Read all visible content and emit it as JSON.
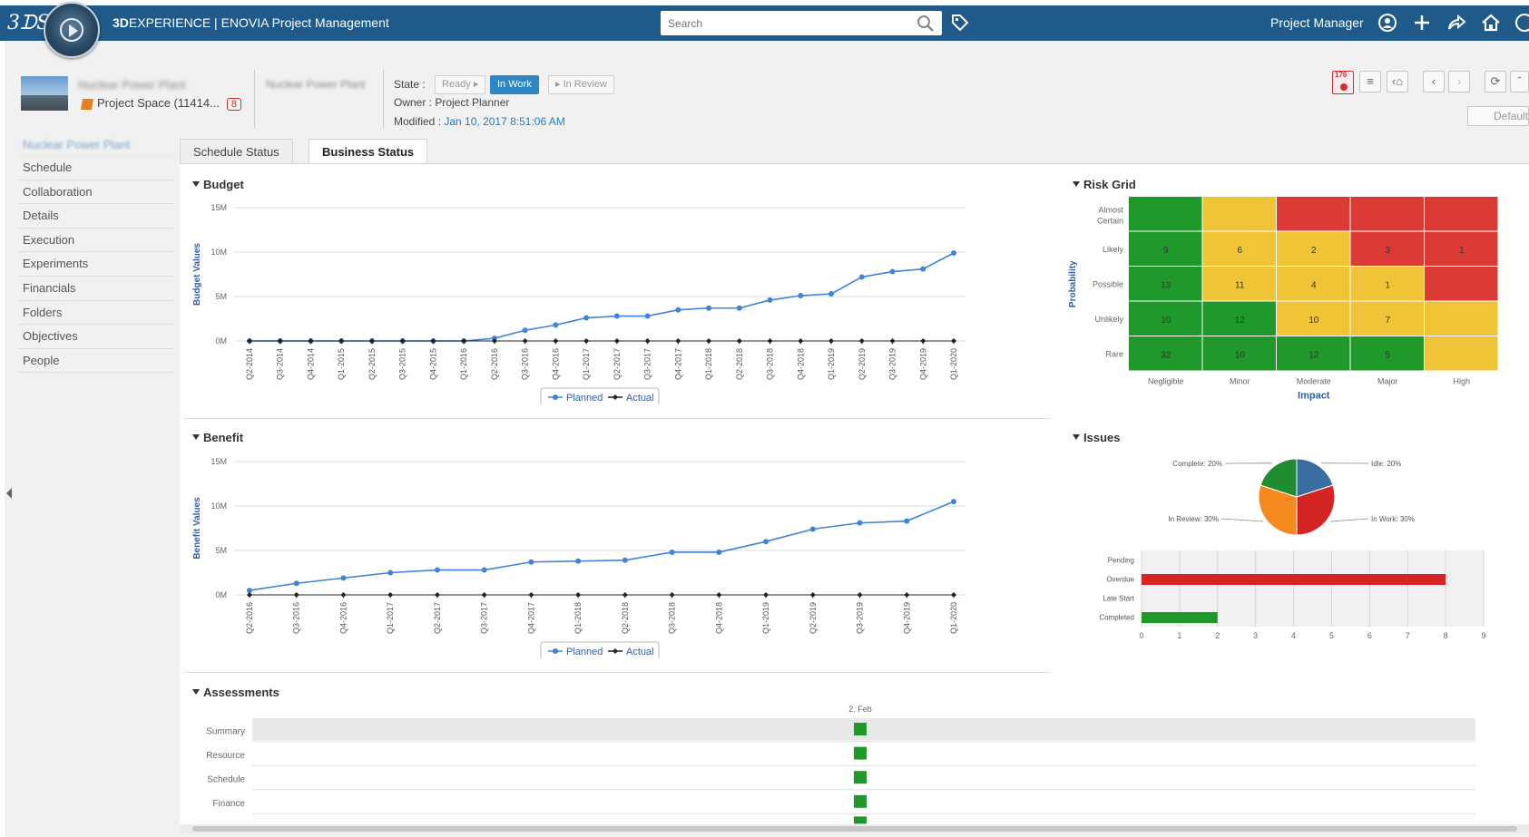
{
  "app": {
    "brand_bold": "3D",
    "brand_rest": "EXPERIENCE | ENOVIA Project Management",
    "search_placeholder": "Search",
    "role": "Project Manager"
  },
  "project": {
    "name": "Nuclear Power Plant",
    "space": "Project Space (11414...",
    "badge": "8",
    "name2": "Nuclear Power Plant",
    "state_label": "State :",
    "states": [
      "Ready",
      "In Work",
      "In Review"
    ],
    "owner": "Owner : Project Planner",
    "modified_label": "Modified :",
    "modified_date": "Jan 10, 2017 8:51:06 AM",
    "notification_count": "176",
    "default_label": "Default"
  },
  "sidebar": {
    "title": "Nuclear Power Plant",
    "items": [
      "Schedule",
      "Collaboration",
      "Details",
      "Execution",
      "Experiments",
      "Financials",
      "Folders",
      "Objectives",
      "People"
    ]
  },
  "tabs": [
    "Schedule Status",
    "Business Status"
  ],
  "sections": {
    "budget": "Budget",
    "benefit": "Benefit",
    "risk": "Risk Grid",
    "issues": "Issues",
    "assessments": "Assessments"
  },
  "chart_data": [
    {
      "id": "budget",
      "type": "line",
      "ylabel": "Budget Values",
      "yticks": [
        "0M",
        "5M",
        "10M",
        "15M"
      ],
      "ylim": [
        0,
        15
      ],
      "categories": [
        "Q2-2014",
        "Q3-2014",
        "Q4-2014",
        "Q1-2015",
        "Q2-2015",
        "Q3-2015",
        "Q4-2015",
        "Q1-2016",
        "Q2-2016",
        "Q3-2016",
        "Q4-2016",
        "Q1-2017",
        "Q2-2017",
        "Q3-2017",
        "Q4-2017",
        "Q1-2018",
        "Q2-2018",
        "Q3-2018",
        "Q4-2018",
        "Q1-2019",
        "Q2-2019",
        "Q3-2019",
        "Q4-2019",
        "Q1-2020"
      ],
      "series": [
        {
          "name": "Planned",
          "color": "#3f84d6",
          "values": [
            0,
            0,
            0,
            0,
            0,
            0,
            0,
            0,
            0.3,
            1.2,
            1.8,
            2.6,
            2.8,
            2.8,
            3.5,
            3.7,
            3.7,
            4.6,
            5.1,
            5.3,
            7.2,
            7.8,
            8.1,
            9.9
          ]
        },
        {
          "name": "Actual",
          "color": "#222222",
          "values": [
            0,
            0,
            0,
            0,
            0,
            0,
            0,
            0,
            0,
            0,
            0,
            0,
            0,
            0,
            0,
            0,
            0,
            0,
            0,
            0,
            0,
            0,
            0,
            0
          ]
        }
      ],
      "legend": "bottom"
    },
    {
      "id": "benefit",
      "type": "line",
      "ylabel": "Benefit Values",
      "yticks": [
        "0M",
        "5M",
        "10M",
        "15M"
      ],
      "ylim": [
        0,
        15
      ],
      "categories": [
        "Q2-2016",
        "Q3-2016",
        "Q4-2016",
        "Q1-2017",
        "Q2-2017",
        "Q3-2017",
        "Q4-2017",
        "Q1-2018",
        "Q2-2018",
        "Q3-2018",
        "Q4-2018",
        "Q1-2019",
        "Q2-2019",
        "Q3-2019",
        "Q4-2019",
        "Q1-2020"
      ],
      "series": [
        {
          "name": "Planned",
          "color": "#3f84d6",
          "values": [
            0.5,
            1.3,
            1.9,
            2.5,
            2.8,
            2.8,
            3.7,
            3.8,
            3.9,
            4.8,
            4.8,
            6.0,
            7.4,
            8.1,
            8.3,
            10.5
          ]
        },
        {
          "name": "Actual",
          "color": "#222222",
          "values": [
            0,
            0,
            0,
            0,
            0,
            0,
            0,
            0,
            0,
            0,
            0,
            0,
            0,
            0,
            0,
            0
          ]
        }
      ],
      "legend": "bottom"
    },
    {
      "id": "risk_grid",
      "type": "heatmap",
      "xlabel": "Impact",
      "ylabel": "Probability",
      "x": [
        "Negligible",
        "Minor",
        "Moderate",
        "Major",
        "High"
      ],
      "y": [
        "Almost Certain",
        "Likely",
        "Possible",
        "Unlikely",
        "Rare"
      ],
      "values": [
        [
          "",
          "",
          "",
          "",
          ""
        ],
        [
          "9",
          "6",
          "2",
          "3",
          "1"
        ],
        [
          "13",
          "11",
          "4",
          "1",
          ""
        ],
        [
          "10",
          "12",
          "10",
          "7",
          ""
        ],
        [
          "32",
          "10",
          "12",
          "5",
          ""
        ]
      ],
      "colors": [
        [
          "#1f9a2a",
          "#f0c437",
          "#dc3a35",
          "#dc3a35",
          "#dc3a35"
        ],
        [
          "#1f9a2a",
          "#f0c437",
          "#f0c437",
          "#dc3a35",
          "#dc3a35"
        ],
        [
          "#1f9a2a",
          "#f0c437",
          "#f0c437",
          "#f0c437",
          "#dc3a35"
        ],
        [
          "#1f9a2a",
          "#1f9a2a",
          "#f0c437",
          "#f0c437",
          "#f0c437"
        ],
        [
          "#1f9a2a",
          "#1f9a2a",
          "#1f9a2a",
          "#1f9a2a",
          "#f0c437"
        ]
      ]
    },
    {
      "id": "issues_pie",
      "type": "pie",
      "slices": [
        {
          "label": "Idle: 20%",
          "value": 20,
          "color": "#3b6ea0"
        },
        {
          "label": "In Work: 30%",
          "value": 30,
          "color": "#d42424"
        },
        {
          "label": "In Review: 30%",
          "value": 30,
          "color": "#f48a1d"
        },
        {
          "label": "Complete: 20%",
          "value": 20,
          "color": "#1f8d2f"
        }
      ]
    },
    {
      "id": "issues_bar",
      "type": "bar",
      "orientation": "horizontal",
      "categories": [
        "Pending",
        "Overdue",
        "Late Start",
        "Completed"
      ],
      "values": [
        0,
        8,
        0,
        2
      ],
      "colors": [
        "#d42424",
        "#d42424",
        "#d42424",
        "#1f9a2a"
      ],
      "xlim": [
        0,
        9
      ],
      "xticks": [
        "0",
        "1",
        "2",
        "3",
        "4",
        "5",
        "6",
        "7",
        "8",
        "9"
      ]
    },
    {
      "id": "assessments",
      "type": "scatter",
      "date_label": "2. Feb",
      "rows": [
        "Summary",
        "Resource",
        "Schedule",
        "Finance"
      ],
      "status_color": "#1f9a2a"
    }
  ]
}
